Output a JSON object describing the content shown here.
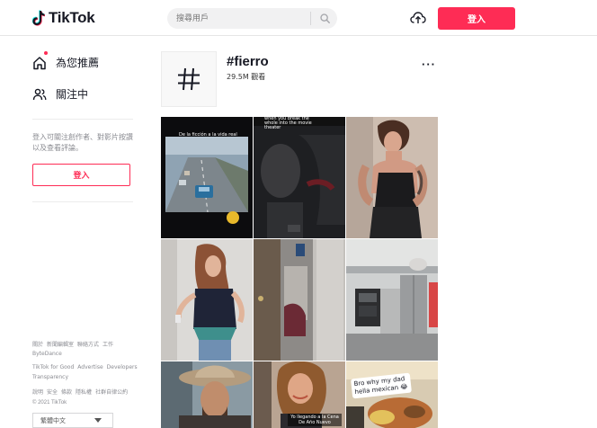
{
  "header": {
    "logo_text": "TikTok",
    "search_placeholder": "搜尋用戶",
    "login_label": "登入"
  },
  "sidebar": {
    "nav": [
      {
        "label": "為您推薦",
        "icon": "home-icon"
      },
      {
        "label": "關注中",
        "icon": "users-icon"
      }
    ],
    "login_prompt": "登入可關注創作者、對影片按讚以及查看評論。",
    "login_label": "登入",
    "footer_row1": [
      "關於",
      "新聞編輯室",
      "聯絡方式",
      "工作"
    ],
    "footer_row1b": [
      "ByteDance"
    ],
    "footer_row2": [
      "TikTok for Good",
      "Advertise",
      "Developers"
    ],
    "footer_row2b": [
      "Transparency"
    ],
    "footer_row3": [
      "說明",
      "安全",
      "條款",
      "隱私權",
      "社群自律公約"
    ],
    "copyright": "© 2021 TikTok",
    "language": "繁體中文"
  },
  "tag": {
    "title": "#fierro",
    "views": "29.5M 觀看",
    "more_label": "···"
  },
  "videos": [
    {
      "caption": "De la ficción a la vida real"
    },
    {
      "caption": "when you break the whole into the movie theater"
    },
    {
      "caption": ""
    },
    {
      "caption": ""
    },
    {
      "caption": ""
    },
    {
      "caption": ""
    },
    {
      "caption": ""
    },
    {
      "caption": "Yo llegando a la Cena De Año Nuevo"
    },
    {
      "caption": "Bro why my dad hella mexican 😂"
    }
  ],
  "colors": {
    "accent": "#fe2c55",
    "text": "#161823",
    "muted": "#8a8b91"
  }
}
